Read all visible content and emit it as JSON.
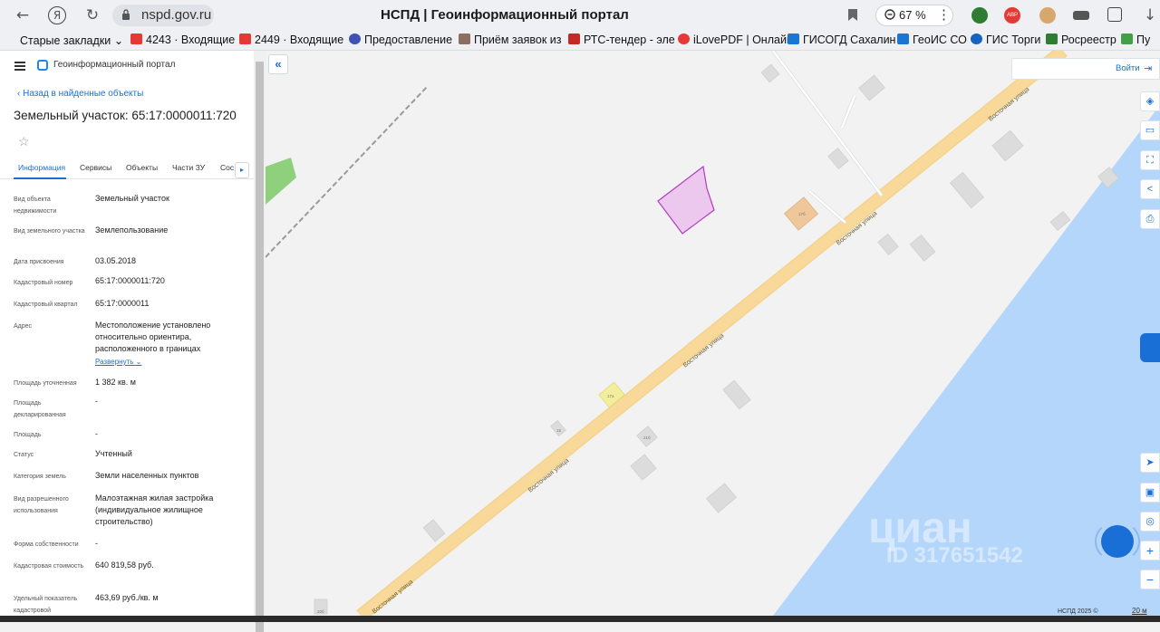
{
  "browser": {
    "url": "nspd.gov.ru",
    "title": "НСПД | Геоинформационный портал",
    "zoom": "67 %"
  },
  "bookmarks": [
    {
      "label": "Старые закладки",
      "icon": "chevron-down-icon",
      "color": "#ffffff"
    },
    {
      "label": "4243 · Входящие",
      "icon": "mail-icon",
      "color": "#e53935"
    },
    {
      "label": "2449 · Входящие",
      "icon": "mail-icon",
      "color": "#e53935"
    },
    {
      "label": "Предоставление",
      "icon": "gov-services-icon",
      "color": "#3f51b5"
    },
    {
      "label": "Приём заявок из",
      "icon": "people-icon",
      "color": "#8d6e63"
    },
    {
      "label": "РТС-тендер - эле",
      "icon": "rts-icon",
      "color": "#c62828"
    },
    {
      "label": "iLovePDF | Онлайн",
      "icon": "heart-icon",
      "color": "#e53935"
    },
    {
      "label": "ГИСОГД Сахалин",
      "icon": "building-icon",
      "color": "#1976d2"
    },
    {
      "label": "ГеоИС СО",
      "icon": "building-icon",
      "color": "#1976d2"
    },
    {
      "label": "ГИС Торги",
      "icon": "emblem-icon",
      "color": "#1565c0"
    },
    {
      "label": "Росреестр",
      "icon": "rosreestr-icon",
      "color": "#2e7d32"
    },
    {
      "label": "Пу",
      "icon": "puzzle-icon",
      "color": "#43a047"
    }
  ],
  "panel": {
    "portal_name": "Геоинформационный портал",
    "back_link": "Назад в найденные объекты",
    "object_title": "Земельный участок: 65:17:0000011:720",
    "tabs": [
      "Информация",
      "Сервисы",
      "Объекты",
      "Части ЗУ",
      "Сос"
    ],
    "properties": [
      {
        "label": "Вид объекта недвижимости",
        "value": "Земельный участок"
      },
      {
        "label": "Вид земельного участка",
        "value": "Землепользование"
      },
      {
        "label": "Дата присвоения",
        "value": "03.05.2018"
      },
      {
        "label": "Кадастровый номер",
        "value": "65:17:0000011:720"
      },
      {
        "label": "Кадастровый квартал",
        "value": "65:17:0000011"
      },
      {
        "label": "Адрес",
        "value": "Местоположение установлено относительно ориентира, расположенного в границах"
      },
      {
        "label": "Площадь уточненная",
        "value": "1 382 кв. м"
      },
      {
        "label": "Площадь декларированная",
        "value": "-"
      },
      {
        "label": "Площадь",
        "value": "-"
      },
      {
        "label": "Статус",
        "value": "Учтенный"
      },
      {
        "label": "Категория земель",
        "value": "Земли населенных пунктов"
      },
      {
        "label": "Вид разрешенного использования",
        "value": "Малоэтажная жилая застройка (индивидуальное жилищное строительство)"
      },
      {
        "label": "Форма собственности",
        "value": "-"
      },
      {
        "label": "Кадастровая стоимость",
        "value": "640 819,58 руб."
      },
      {
        "label": "Удельный показатель кадастровой",
        "value": "463,69 руб./кв. м"
      }
    ],
    "expand_label": "Развернуть"
  },
  "map": {
    "login_label": "Войти",
    "street_name": "Восточная улица",
    "house_numbers": [
      "17б",
      "17а",
      "18",
      "21б",
      "20б"
    ],
    "copyright": "НСПД 2025 ©",
    "scale": "20 м",
    "watermark_brand": "циан",
    "watermark_id": "ID 317651542",
    "colors": {
      "road": "#f8d99a",
      "water": "#b5d6fb",
      "parcel_fill": "#ecc8ee",
      "parcel_stroke": "#b13cc2",
      "building": "#dcdcdc",
      "accent": "#1a6fd6"
    }
  }
}
